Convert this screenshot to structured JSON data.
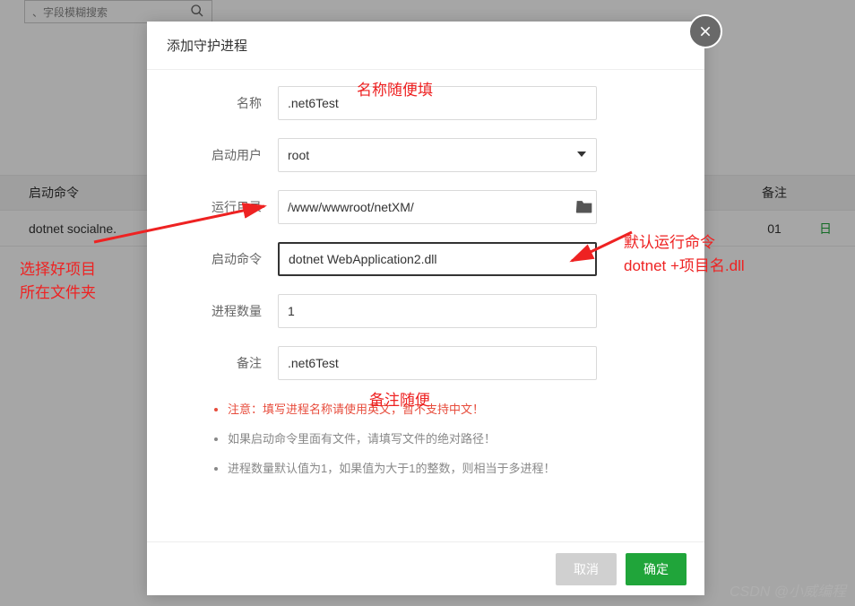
{
  "background": {
    "search_placeholder": "、字段模糊搜索",
    "table_headers": {
      "col1": "启动命令",
      "col2": "备注",
      "col3": ""
    },
    "table_row": {
      "col1": "dotnet socialne.",
      "col2": "01",
      "col3": "日"
    }
  },
  "modal": {
    "title": "添加守护进程",
    "fields": {
      "name": {
        "label": "名称",
        "value": ".net6Test"
      },
      "user": {
        "label": "启动用户",
        "value": "root"
      },
      "rundir": {
        "label": "运行目录",
        "value": "/www/wwwroot/netXM/"
      },
      "startcmd": {
        "label": "启动命令",
        "value": "dotnet WebApplication2.dll"
      },
      "count": {
        "label": "进程数量",
        "value": "1"
      },
      "remark": {
        "label": "备注",
        "value": ".net6Test"
      }
    },
    "notes": {
      "note1": "注意：填写进程名称请使用英文，暂不支持中文！",
      "note2": "如果启动命令里面有文件，请填写文件的绝对路径！",
      "note3": "进程数量默认值为1，如果值为大于1的整数，则相当于多进程！"
    },
    "footer": {
      "cancel": "取消",
      "confirm": "确定"
    }
  },
  "annotations": {
    "a1": "名称随便填",
    "a2_line1": "选择好项目",
    "a2_line2": "所在文件夹",
    "a3_line1": "默认运行命令",
    "a3_line2": "dotnet +项目名.dll",
    "a4": "备注随便"
  },
  "watermark": "CSDN @小威编程"
}
